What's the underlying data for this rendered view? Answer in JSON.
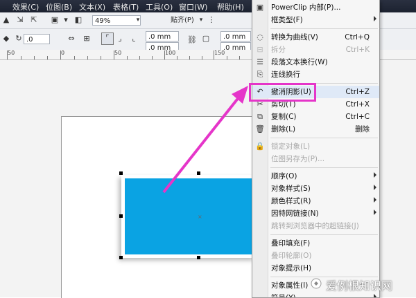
{
  "menubar": {
    "items": [
      "效果(C)",
      "位图(B)",
      "文本(X)",
      "表格(T)",
      "工具(O)",
      "窗口(W)",
      "帮助(H)"
    ]
  },
  "toolbar": {
    "zoom_value": "49%",
    "snap_label": "贴齐(P)",
    "pos_x": ".0",
    "width1": ".0 mm",
    "width2": ".0 mm",
    "width3": ".0 mm",
    "width4": ".0 mm"
  },
  "ruler": {
    "labels": [
      "50",
      "0",
      "50",
      "100",
      "150"
    ]
  },
  "context_menu": {
    "items": [
      {
        "icon": "powerclip-icon",
        "label": "PowerClip 内部(P)...",
        "shortcut": "",
        "arrow": false,
        "disabled": false
      },
      {
        "icon": "",
        "label": "框类型(F)",
        "shortcut": "",
        "arrow": true,
        "disabled": false
      },
      {
        "sep": true
      },
      {
        "icon": "convert-curve-icon",
        "label": "转换为曲线(V)",
        "shortcut": "Ctrl+Q",
        "arrow": false,
        "disabled": false
      },
      {
        "icon": "split-icon",
        "label": "拆分",
        "shortcut": "Ctrl+K",
        "arrow": false,
        "disabled": true
      },
      {
        "icon": "paragraph-icon",
        "label": "段落文本换行(W)",
        "shortcut": "",
        "arrow": false,
        "disabled": false
      },
      {
        "icon": "connect-icon",
        "label": "连线换行",
        "shortcut": "",
        "arrow": false,
        "disabled": false
      },
      {
        "sep": true
      },
      {
        "icon": "undo-icon",
        "label": "撤消阴影(U)",
        "shortcut": "Ctrl+Z",
        "arrow": false,
        "disabled": false,
        "highlight": true
      },
      {
        "icon": "cut-icon",
        "label": "剪切(T)",
        "shortcut": "Ctrl+X",
        "arrow": false,
        "disabled": false
      },
      {
        "icon": "copy-icon",
        "label": "复制(C)",
        "shortcut": "Ctrl+C",
        "arrow": false,
        "disabled": false
      },
      {
        "icon": "delete-icon",
        "label": "删除(L)",
        "shortcut": "删除",
        "arrow": false,
        "disabled": false
      },
      {
        "sep": true
      },
      {
        "icon": "lock-icon",
        "label": "锁定对象(L)",
        "shortcut": "",
        "arrow": false,
        "disabled": true
      },
      {
        "icon": "",
        "label": "位图另存为(P)...",
        "shortcut": "",
        "arrow": false,
        "disabled": true
      },
      {
        "sep": true
      },
      {
        "icon": "",
        "label": "顺序(O)",
        "shortcut": "",
        "arrow": true,
        "disabled": false
      },
      {
        "icon": "",
        "label": "对象样式(S)",
        "shortcut": "",
        "arrow": true,
        "disabled": false
      },
      {
        "icon": "",
        "label": "颜色样式(R)",
        "shortcut": "",
        "arrow": true,
        "disabled": false
      },
      {
        "icon": "",
        "label": "因特网链接(N)",
        "shortcut": "",
        "arrow": true,
        "disabled": false
      },
      {
        "icon": "",
        "label": "跳转到浏览器中的超链接(J)",
        "shortcut": "",
        "arrow": false,
        "disabled": true
      },
      {
        "sep": true
      },
      {
        "icon": "",
        "label": "叠印填充(F)",
        "shortcut": "",
        "arrow": false,
        "disabled": false
      },
      {
        "icon": "",
        "label": "叠印轮廓(O)",
        "shortcut": "",
        "arrow": false,
        "disabled": true
      },
      {
        "icon": "",
        "label": "对象提示(H)",
        "shortcut": "",
        "arrow": false,
        "disabled": false
      },
      {
        "sep": true
      },
      {
        "icon": "",
        "label": "对象属性(I)",
        "shortcut": "",
        "arrow": false,
        "disabled": false
      },
      {
        "icon": "",
        "label": "符号(Y)",
        "shortcut": "",
        "arrow": true,
        "disabled": false
      }
    ]
  },
  "watermark": "爱例根知识网",
  "colors": {
    "rect_fill": "#0aa3e3",
    "highlight_border": "#e535c9",
    "arrow": "#e535c9"
  }
}
